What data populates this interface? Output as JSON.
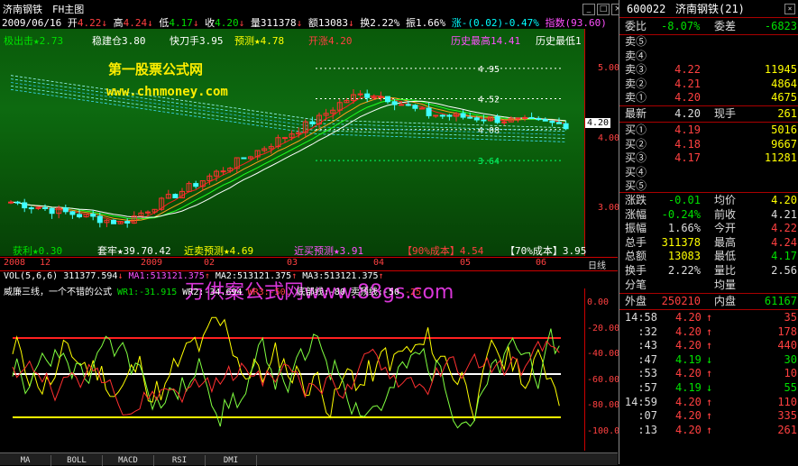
{
  "title": {
    "name": "济南钢铁",
    "frame": "FH主图"
  },
  "quote_line": {
    "date": "2009/06/16",
    "open_label": "开",
    "open": "4.22",
    "open_arrow": "↓",
    "high_label": "高",
    "high": "4.24",
    "high_arrow": "↓",
    "low_label": "低",
    "low": "4.17",
    "low_arrow": "↓",
    "close_label": "收",
    "close": "4.20",
    "close_arrow": "↓",
    "vol": "量311378",
    "vol_arrow": "↓",
    "amount": "额13083",
    "amount_arrow": "↓",
    "turnover": "换2.22%",
    "amplitude": "振1.66%",
    "change": "涨-(0.02)-0.47%",
    "index": "指数(93.60)"
  },
  "indicator_line": [
    {
      "text": "极出击★2.73",
      "color": "#00e000"
    },
    {
      "text": "稳建仓3.80",
      "color": "#ffffff"
    },
    {
      "text": "快刀手3.95",
      "color": "#ffffff"
    },
    {
      "text": "预测★4.78",
      "color": "#ffff00"
    },
    {
      "text": "开涨4.20",
      "color": "#ff4040"
    },
    {
      "text": "历史最高14.41",
      "color": "#ff50ff"
    },
    {
      "text": "历史最低1",
      "color": "#ffffff"
    }
  ],
  "watermark": {
    "title": "第一股票公式网",
    "url": "www.chnmoney.com"
  },
  "levels": [
    {
      "label": "4.95",
      "color": "#ffffff"
    },
    {
      "label": "4.52",
      "color": "#ffffff"
    },
    {
      "label": "4.08",
      "color": "#ffffff"
    },
    {
      "label": "3.64",
      "color": "#00ff66"
    }
  ],
  "price_axis": [
    "5.00",
    "4.00",
    "3.00"
  ],
  "price_marker": "4.20",
  "bottom_line": [
    {
      "text": "获利★0.30",
      "color": "#00e000"
    },
    {
      "text": "套牢★39.70.42",
      "color": "#ffffff"
    },
    {
      "text": "近卖预测★4.69",
      "color": "#ffff00"
    },
    {
      "text": "近买预测★3.91",
      "color": "#ff50ff"
    },
    {
      "text": "【90%成本】4.54",
      "color": "#ff4040"
    },
    {
      "text": "【70%成本】3.95",
      "color": "#ffffff"
    }
  ],
  "date_axis": [
    "2008",
    "12",
    "2009",
    "02",
    "03",
    "04",
    "05",
    "06"
  ],
  "date_axis_label": "日线",
  "vol_line": {
    "name": "VOL(5,6,6)",
    "vol": "311377.594",
    "vol_arrow": "↓",
    "ma1": "MA1:513121.375",
    "ma1_arrow": "↑",
    "ma2": "MA2:513121.375",
    "ma2_arrow": "↑",
    "ma3": "MA3:513121.375",
    "ma3_arrow": "↑"
  },
  "wr_line": {
    "name": "威廉三线，一个不错的公式",
    "wr1": "WR1:-31.915",
    "wr2": "WR2:-34.694",
    "wr3": "WR3:-50.",
    "bottom": "底部线:-80",
    "sell": "卖顶线:-50",
    "extra": "-25"
  },
  "watermark2": "万供案公式网www.88gs.com",
  "lower_axis": [
    "0.00",
    "-20.00",
    "-40.00",
    "-60.00",
    "-80.00",
    "-100.0"
  ],
  "tabs": [
    "MA",
    "BOLL",
    "MACD",
    "RSI",
    "DMI"
  ],
  "stock": {
    "code": "600022",
    "name": "济南钢铁(21)"
  },
  "ratio": {
    "label1": "委比",
    "value1": "-8.07%",
    "label2": "委差",
    "value2": "-6823"
  },
  "asks": [
    {
      "label": "卖⑤",
      "price": "",
      "vol": ""
    },
    {
      "label": "卖④",
      "price": "",
      "vol": ""
    },
    {
      "label": "卖③",
      "price": "4.22",
      "vol": "11945"
    },
    {
      "label": "卖②",
      "price": "4.21",
      "vol": "4864"
    },
    {
      "label": "卖①",
      "price": "4.20",
      "vol": "4675"
    }
  ],
  "latest": {
    "label": "最新",
    "price": "4.20",
    "label2": "现手",
    "value2": "261"
  },
  "bids": [
    {
      "label": "买①",
      "price": "4.19",
      "vol": "5016"
    },
    {
      "label": "买②",
      "price": "4.18",
      "vol": "9667"
    },
    {
      "label": "买③",
      "price": "4.17",
      "vol": "11281"
    },
    {
      "label": "买④",
      "price": "",
      "vol": ""
    },
    {
      "label": "买⑤",
      "price": "",
      "vol": ""
    }
  ],
  "stats": [
    {
      "l1": "涨跌",
      "v1": "-0.01",
      "c1": "#00e000",
      "l2": "均价",
      "v2": "4.20",
      "c2": "#ffff00"
    },
    {
      "l1": "涨幅",
      "v1": "-0.24%",
      "c1": "#00e000",
      "l2": "前收",
      "v2": "4.21",
      "c2": "#dddddd"
    },
    {
      "l1": "振幅",
      "v1": "1.66%",
      "c1": "#dddddd",
      "l2": "今开",
      "v2": "4.22",
      "c2": "#ff4040"
    },
    {
      "l1": "总手",
      "v1": "311378",
      "c1": "#ffff00",
      "l2": "最高",
      "v2": "4.24",
      "c2": "#ff4040"
    },
    {
      "l1": "总额",
      "v1": "13083",
      "c1": "#ffff00",
      "l2": "最低",
      "v2": "4.17",
      "c2": "#00e000"
    },
    {
      "l1": "换手",
      "v1": "2.22%",
      "c1": "#dddddd",
      "l2": "量比",
      "v2": "2.56",
      "c2": "#dddddd"
    },
    {
      "l1": "分笔",
      "v1": "",
      "c1": "#dddddd",
      "l2": "均量",
      "v2": "",
      "c2": "#dddddd"
    }
  ],
  "outer_inner": {
    "l1": "外盘",
    "v1": "250210",
    "l2": "内盘",
    "v2": "61167"
  },
  "ticks": [
    {
      "time": "14:58",
      "price": "4.20",
      "arrow": "↑",
      "vol": "35",
      "color": "#ff4040"
    },
    {
      "time": ":32",
      "price": "4.20",
      "arrow": "↑",
      "vol": "178",
      "color": "#ff4040"
    },
    {
      "time": ":43",
      "price": "4.20",
      "arrow": "↑",
      "vol": "440",
      "color": "#ff4040"
    },
    {
      "time": ":47",
      "price": "4.19",
      "arrow": "↓",
      "vol": "30",
      "color": "#00e000"
    },
    {
      "time": ":53",
      "price": "4.20",
      "arrow": "↑",
      "vol": "10",
      "color": "#ff4040"
    },
    {
      "time": ":57",
      "price": "4.19",
      "arrow": "↓",
      "vol": "55",
      "color": "#00e000"
    },
    {
      "time": "14:59",
      "price": "4.20",
      "arrow": "↑",
      "vol": "110",
      "color": "#ff4040"
    },
    {
      "time": ":07",
      "price": "4.20",
      "arrow": "↑",
      "vol": "335",
      "color": "#ff4040"
    },
    {
      "time": ":13",
      "price": "4.20",
      "arrow": "↑",
      "vol": "261",
      "color": "#ff4040"
    }
  ]
}
